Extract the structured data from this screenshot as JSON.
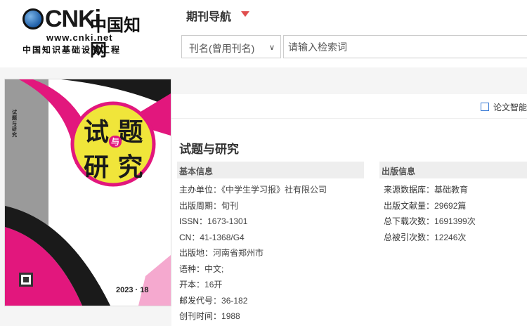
{
  "logo": {
    "letters": "CNKi",
    "chinese": "中国知网",
    "url": "www.cnki.net",
    "tagline": "中国知识基础设施工程"
  },
  "nav": {
    "title": "期刊导航"
  },
  "search": {
    "field_selected": "刊名(曾用刊名)",
    "placeholder": "请输入检索词"
  },
  "toolbar": {
    "ai_link": "论文智能"
  },
  "journal": {
    "title": "试题与研究",
    "cover": {
      "title_top": "试 题",
      "title_mid": "与",
      "title_bottom": "研 究",
      "issue": "2023 · 18",
      "side_text": "试题与研究"
    }
  },
  "basic_info": {
    "heading": "基本信息",
    "items": [
      {
        "label": "主办单位：",
        "value": "《中学生学习报》社有限公司"
      },
      {
        "label": "出版周期：",
        "value": "旬刊"
      },
      {
        "label": "ISSN：",
        "value": "1673-1301"
      },
      {
        "label": "CN：",
        "value": "41-1368/G4"
      },
      {
        "label": "出版地：",
        "value": "河南省郑州市"
      },
      {
        "label": "语种：",
        "value": "中文;"
      },
      {
        "label": "开本：",
        "value": "16开"
      },
      {
        "label": "邮发代号：",
        "value": "36-182"
      },
      {
        "label": "创刊时间：",
        "value": "1988"
      }
    ]
  },
  "pub_info": {
    "heading": "出版信息",
    "items": [
      {
        "label": "来源数据库：",
        "value": "基础教育"
      },
      {
        "label": "出版文献量：",
        "value": "29692篇"
      },
      {
        "label": "总下载次数：",
        "value": "1691399次"
      },
      {
        "label": "总被引次数：",
        "value": "12246次"
      }
    ]
  }
}
